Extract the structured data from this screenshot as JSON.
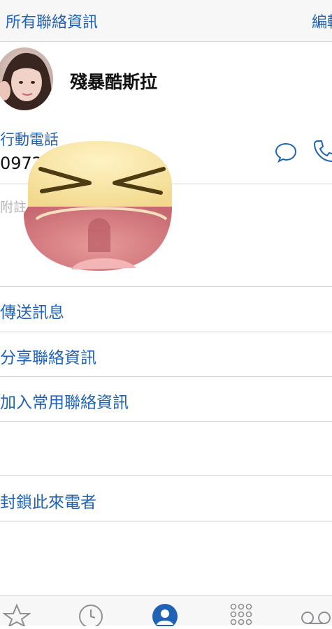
{
  "nav": {
    "back_label": "所有聯絡資訊",
    "edit_label": "編輯"
  },
  "contact": {
    "name": "殘暴酷斯拉",
    "phone_label": "行動電話",
    "phone_number": "0972",
    "notes_label": "附註"
  },
  "actions": {
    "send_message": "傳送訊息",
    "share_contact": "分享聯絡資訊",
    "add_favorite": "加入常用聯絡資訊",
    "block_caller": "封鎖此來電者"
  },
  "tabs": [
    {
      "icon": "star-icon",
      "name": "favorites"
    },
    {
      "icon": "clock-icon",
      "name": "recents"
    },
    {
      "icon": "person-icon",
      "name": "contacts",
      "active": true
    },
    {
      "icon": "keypad-icon",
      "name": "keypad"
    },
    {
      "icon": "voicemail-icon",
      "name": "voicemail"
    }
  ],
  "colors": {
    "accent": "#1f62b6",
    "divider": "#d4d4d7",
    "notes_placeholder": "#b5b5b8"
  }
}
